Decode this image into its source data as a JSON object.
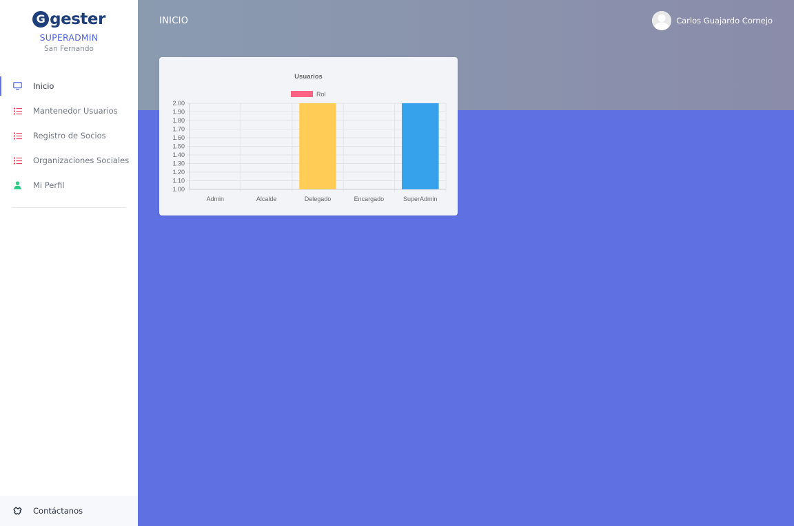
{
  "sidebar": {
    "logo": {
      "letter": "G",
      "text": "gester"
    },
    "role": "SUPERADMIN",
    "city": "San Fernando",
    "items": [
      {
        "label": "Inicio",
        "icon": "monitor-icon",
        "active": true
      },
      {
        "label": "Mantenedor Usuarios",
        "icon": "list-icon"
      },
      {
        "label": "Registro de Socios",
        "icon": "list-icon"
      },
      {
        "label": "Organizaciones Sociales",
        "icon": "list-icon"
      },
      {
        "label": "Mi Perfil",
        "icon": "user-icon"
      }
    ],
    "contact": {
      "label": "Contáctanos",
      "icon": "handshake-icon"
    }
  },
  "header": {
    "title": "INICIO",
    "user_name": "Carlos Guajardo Cornejo"
  },
  "colors": {
    "primary": "#5e72e4",
    "list_icon": "#f5365c",
    "user_icon": "#2dce89",
    "bar_delegado": "#ffcd56",
    "bar_superadmin": "#36a2eb",
    "legend": "#ff6384"
  },
  "chart_data": {
    "type": "bar",
    "title": "Usuarios",
    "legend": "Rol",
    "categories": [
      "Admin",
      "Alcalde",
      "Delegado",
      "Encargado",
      "SuperAdmin"
    ],
    "values": [
      null,
      null,
      2,
      null,
      2
    ],
    "bar_colors": [
      null,
      null,
      "#ffcd56",
      null,
      "#36a2eb"
    ],
    "ylim": [
      1.0,
      2.0
    ],
    "yticks": [
      "2.00",
      "1.90",
      "1.80",
      "1.70",
      "1.60",
      "1.50",
      "1.40",
      "1.30",
      "1.20",
      "1.10",
      "1.00"
    ],
    "grid": true
  }
}
